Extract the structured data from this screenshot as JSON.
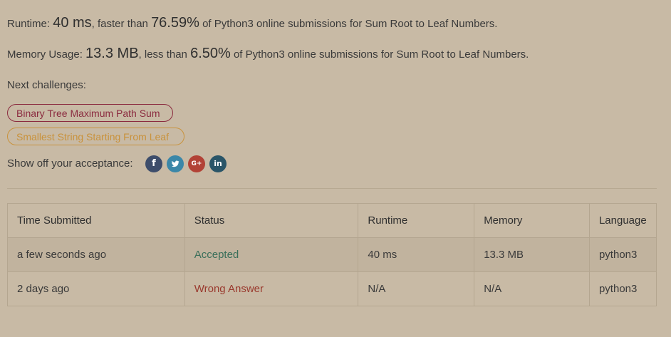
{
  "runtime": {
    "label": "Runtime:",
    "value": "40 ms",
    "middle": ", faster than",
    "percent": "76.59%",
    "suffix": "of Python3 online submissions for Sum Root to Leaf Numbers."
  },
  "memory": {
    "label": "Memory Usage:",
    "value": "13.3 MB",
    "middle": ", less than",
    "percent": "6.50%",
    "suffix": "of Python3 online submissions for Sum Root to Leaf Numbers."
  },
  "next": {
    "label": "Next challenges:",
    "challenges": [
      {
        "title": "Binary Tree Maximum Path Sum",
        "color": "#8b2b3f"
      },
      {
        "title": "Smallest String Starting From Leaf",
        "color": "#c9923c"
      }
    ]
  },
  "share": {
    "label": "Show off your acceptance:",
    "icons": [
      {
        "name": "facebook-icon",
        "glyph": "f"
      },
      {
        "name": "twitter-icon",
        "glyph": "t"
      },
      {
        "name": "google-plus-icon",
        "glyph": "G+"
      },
      {
        "name": "linkedin-icon",
        "glyph": "in"
      }
    ]
  },
  "table": {
    "headers": [
      "Time Submitted",
      "Status",
      "Runtime",
      "Memory",
      "Language"
    ],
    "rows": [
      {
        "time": "a few seconds ago",
        "status": "Accepted",
        "runtime": "40 ms",
        "memory": "13.3 MB",
        "language": "python3"
      },
      {
        "time": "2 days ago",
        "status": "Wrong Answer",
        "runtime": "N/A",
        "memory": "N/A",
        "language": "python3"
      }
    ]
  },
  "colors": {
    "background": "#c8baa5",
    "accepted": "#3a6f5a",
    "wrong_answer": "#9a3a2e",
    "hard": "#8b2b3f",
    "medium": "#c9923c"
  }
}
